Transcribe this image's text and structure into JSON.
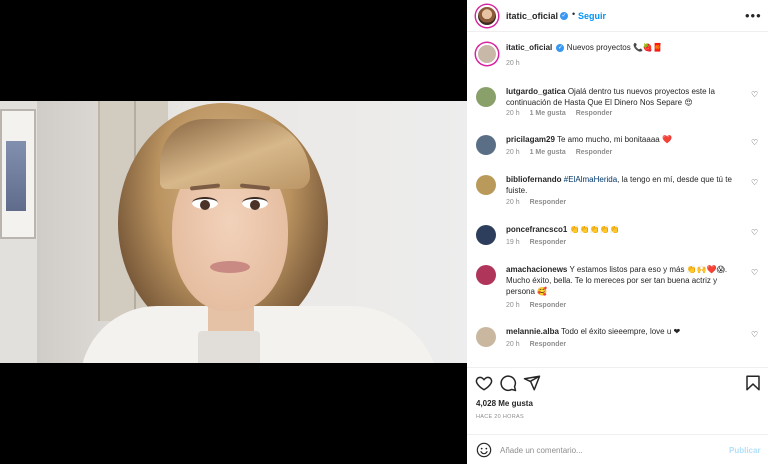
{
  "post_header": {
    "username": "itatic_oficial",
    "separator": "•",
    "follow_label": "Seguir",
    "more_label": "•••"
  },
  "caption": {
    "username": "itatic_oficial",
    "text": "Nuevos proyectos 📞🍓🧧",
    "time": "20 h"
  },
  "comments": [
    {
      "username": "lutgardo_gatica",
      "text": "Ojalá dentro tus nuevos proyectos este la continuación de Hasta Que El Dinero Nos Separe 😍",
      "time": "20 h",
      "likes": "1 Me gusta",
      "reply": "Responder"
    },
    {
      "username": "pricilagam29",
      "text": "Te amo mucho, mi bonitaaaa ❤️",
      "time": "20 h",
      "likes": "1 Me gusta",
      "reply": "Responder"
    },
    {
      "username": "bibliofernando",
      "tag": "#ElAlmaHerida",
      "text": ", la tengo en mí, desde que tú te fuiste.",
      "time": "20 h",
      "reply": "Responder"
    },
    {
      "username": "poncefrancsco1",
      "text": "👏👏👏👏👏",
      "time": "19 h",
      "reply": "Responder"
    },
    {
      "username": "amachacionews",
      "text": "Y estamos listos para eso y más 👏🙌❤️😱. Mucho éxito, bella. Te lo mereces por ser tan buena actriz y persona 🥰",
      "time": "20 h",
      "reply": "Responder"
    },
    {
      "username": "melannie.alba",
      "text": "Todo el éxito sieeempre, love u ❤",
      "time": "20 h",
      "reply": "Responder"
    }
  ],
  "footer": {
    "likes": "4,028 Me gusta",
    "ago": "HACE 20 HORAS",
    "comment_placeholder": "Añade un comentario...",
    "publish_label": "Publicar"
  },
  "colors": {
    "link_blue": "#0095f6",
    "publish_disabled": "#b2dffc",
    "muted": "#8e8e8e",
    "text": "#262626"
  },
  "icons": [
    "heart-icon",
    "comment-icon",
    "share-icon",
    "bookmark-icon",
    "emoji-icon",
    "verified-icon",
    "more-options-icon"
  ]
}
